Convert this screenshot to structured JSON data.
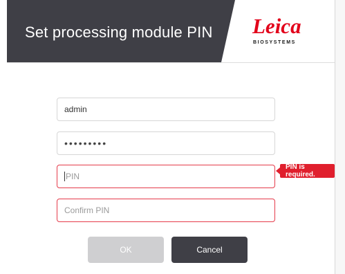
{
  "dialog": {
    "title": "Set processing module PIN"
  },
  "logo": {
    "word": "Leica",
    "subtitle": "BIOSYSTEMS"
  },
  "form": {
    "username_value": "admin",
    "password_mask": "•••••••••",
    "pin_placeholder": "PIN",
    "confirm_pin_placeholder": "Confirm PIN",
    "pin_error": "PIN is required."
  },
  "buttons": {
    "ok_label": "OK",
    "cancel_label": "Cancel"
  },
  "colors": {
    "header_bg": "#3f3f46",
    "brand_red": "#e2001a",
    "error_red": "#e53a4a",
    "ok_disabled": "#cfcfd1",
    "cancel_bg": "#3f3f46"
  }
}
